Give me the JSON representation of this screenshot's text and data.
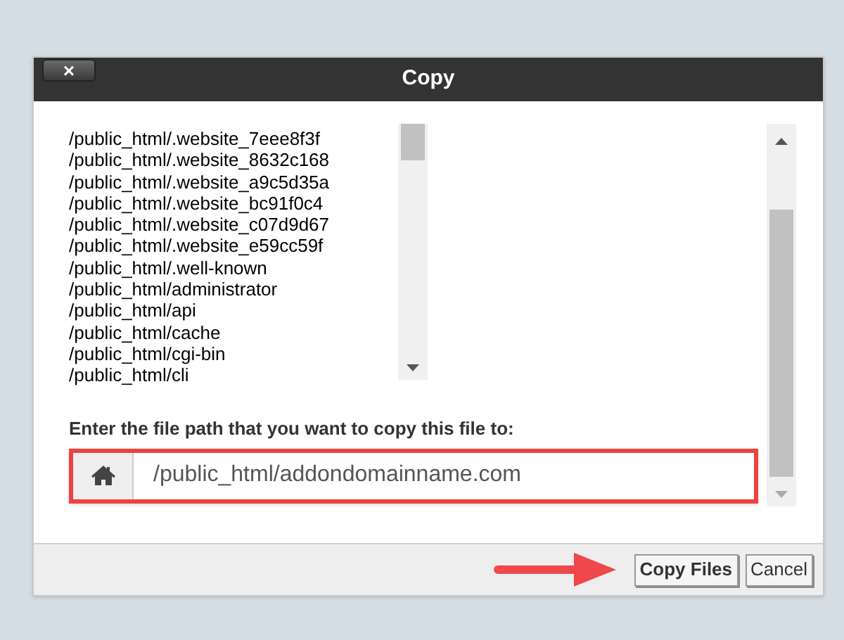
{
  "dialog": {
    "title": "Copy",
    "close_button": "×"
  },
  "folders": [
    "/public_html/.website_7eee8f3f",
    "/public_html/.website_8632c168",
    "/public_html/.website_a9c5d35a",
    "/public_html/.website_bc91f0c4",
    "/public_html/.website_c07d9d67",
    "/public_html/.website_e59cc59f",
    "/public_html/.well-known",
    "/public_html/administrator",
    "/public_html/api",
    "/public_html/cache",
    "/public_html/cgi-bin",
    "/public_html/cli"
  ],
  "destination": {
    "label": "Enter the file path that you want to copy this file to:",
    "value": "/public_html/addondomainname.com"
  },
  "buttons": [
    {
      "label": "Copy Files",
      "kind": "primary"
    },
    {
      "label": "Cancel",
      "kind": "secondary"
    }
  ]
}
